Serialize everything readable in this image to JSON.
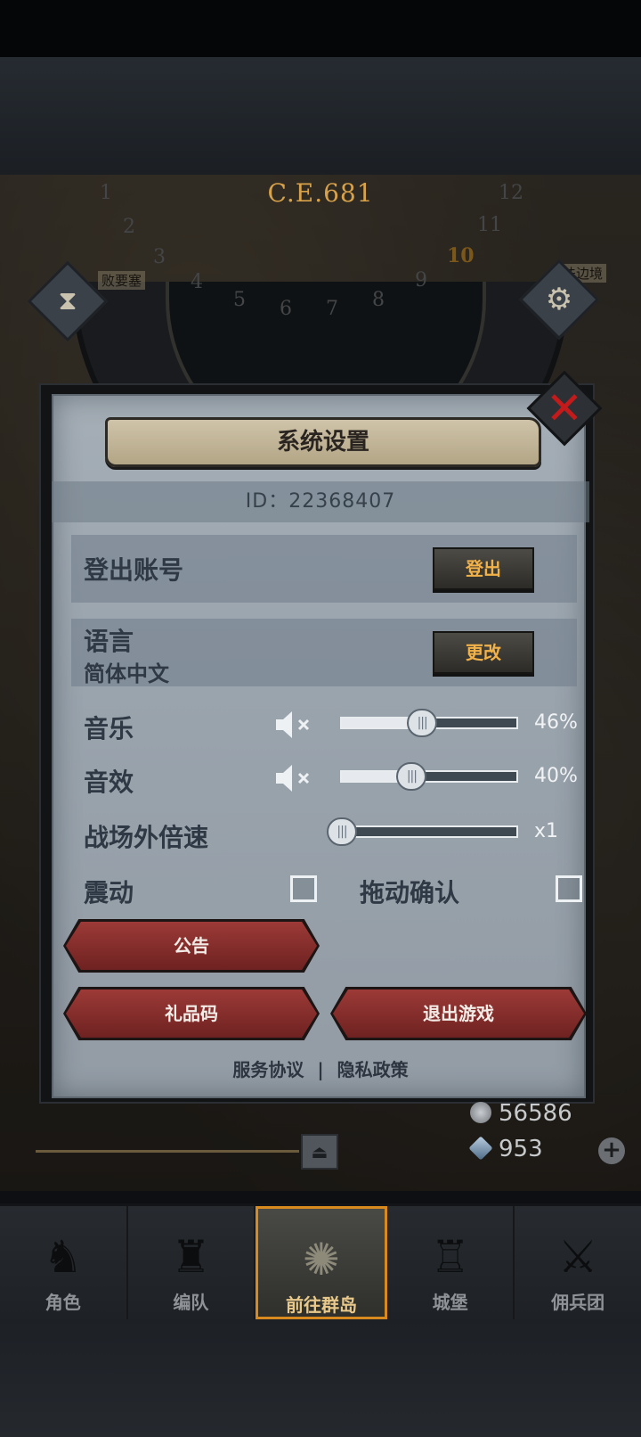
{
  "map": {
    "era": "C.E.681",
    "clock_numbers": [
      "1",
      "2",
      "3",
      "4",
      "5",
      "6",
      "7",
      "8",
      "9",
      "10",
      "11",
      "12"
    ],
    "active_number": "10",
    "labels": [
      "败要塞",
      "法边境"
    ]
  },
  "dialog": {
    "title": "系统设置",
    "id_text": "ID：22368407",
    "logout": {
      "label": "登出账号",
      "button": "登出"
    },
    "language": {
      "label": "语言",
      "value": "简体中文",
      "button": "更改"
    },
    "music": {
      "label": "音乐",
      "value": "46%",
      "level": 46,
      "icon": "mute-icon"
    },
    "sfx": {
      "label": "音效",
      "value": "40%",
      "level": 40,
      "icon": "mute-icon"
    },
    "speed": {
      "label": "战场外倍速",
      "value": "x1",
      "level": 0
    },
    "vibration": {
      "label": "震动",
      "checked": false
    },
    "drag_confirm": {
      "label": "拖动确认",
      "checked": false
    },
    "buttons": {
      "notice": "公告",
      "gift_code": "礼品码",
      "exit_game": "退出游戏"
    },
    "footer": {
      "terms": "服务协议",
      "separator": "|",
      "privacy": "隐私政策"
    },
    "close_icon": "close-x-icon"
  },
  "currency": {
    "silver": "56586",
    "crystal": "953",
    "silver_icon": "silver-coin-icon",
    "crystal_icon": "crystal-icon"
  },
  "nav": {
    "items": [
      {
        "label": "角色",
        "icon": "knight-icon"
      },
      {
        "label": "编队",
        "icon": "helmet-icon"
      },
      {
        "label": "前往群岛",
        "icon": "compass-island-icon"
      },
      {
        "label": "城堡",
        "icon": "castle-icon"
      },
      {
        "label": "佣兵团",
        "icon": "mercenary-icon"
      }
    ],
    "active_index": 2
  },
  "colors": {
    "accent_orange": "#d98a1f",
    "close_red": "#c31b1b",
    "button_gold_text": "#f2b24a",
    "red_button": "#8a2e2c"
  }
}
